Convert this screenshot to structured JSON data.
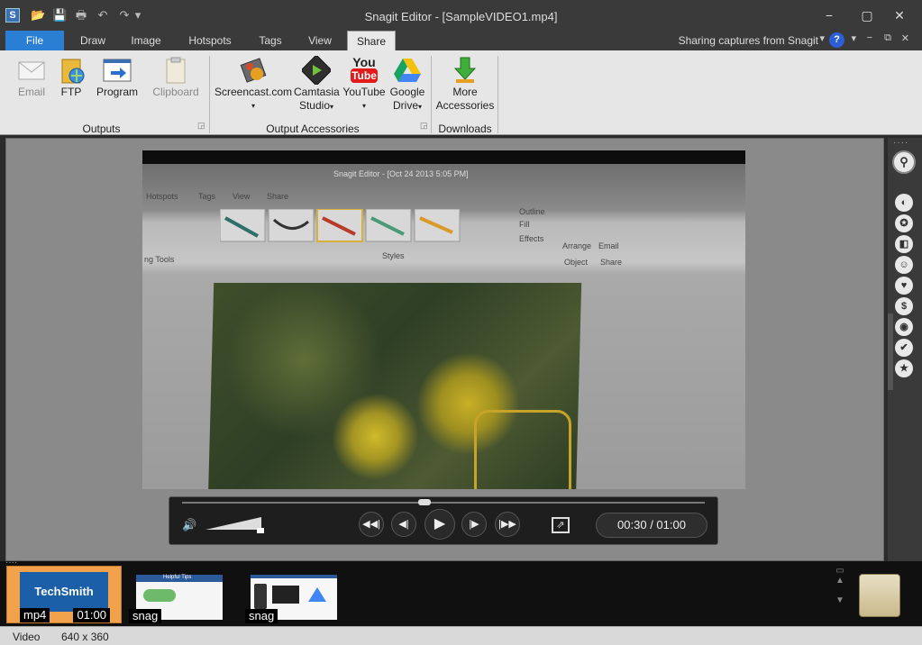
{
  "window": {
    "title": "Snagit Editor - [SampleVIDEO1.mp4]",
    "minimize": "−",
    "maximize": "▢",
    "close": "✕"
  },
  "qat": {
    "open": "📂",
    "save": "💾",
    "print": "🖶",
    "undo": "↶",
    "redo": "↷",
    "customize": "▾"
  },
  "tabs": [
    {
      "label": "File"
    },
    {
      "label": "Draw"
    },
    {
      "label": "Image"
    },
    {
      "label": "Hotspots"
    },
    {
      "label": "Tags"
    },
    {
      "label": "View"
    },
    {
      "label": "Share"
    }
  ],
  "sharing_text": "Sharing captures from Snagit",
  "help": "?",
  "ribbon_ctl": {
    "collapse": "▾",
    "minimize": "−",
    "restore": "⧉",
    "close": "✕"
  },
  "ribbon": {
    "outputs": {
      "label": "Outputs",
      "items": [
        {
          "label": "Email"
        },
        {
          "label": "FTP"
        },
        {
          "label": "Program"
        },
        {
          "label": "Clipboard"
        }
      ]
    },
    "accessories": {
      "label": "Output Accessories",
      "items": [
        {
          "label": "Screencast.com",
          "label2": ""
        },
        {
          "label": "Camtasia",
          "label2": "Studio"
        },
        {
          "label": "YouTube",
          "label2": ""
        },
        {
          "label": "Google",
          "label2": "Drive"
        }
      ]
    },
    "downloads": {
      "label": "Downloads",
      "items": [
        {
          "label": "More",
          "label2": "Accessories"
        }
      ]
    },
    "youtube_logo": {
      "you": "You",
      "tube": "Tube"
    }
  },
  "video_ghost": {
    "title": "Snagit Editor - [Oct 24 2013 5:05 PM]",
    "menu": [
      "Hotspots",
      "Tags",
      "View",
      "Share"
    ],
    "styles": "Styles",
    "tools": "ng Tools",
    "outline": "Outline",
    "fill": "Fill",
    "effects": "Effects",
    "arrange": "Arrange",
    "email": "Email",
    "object": "Object",
    "share": "Share"
  },
  "player": {
    "time": "00:30 / 01:00",
    "volume": "🔊",
    "rewind": "◀◀|",
    "step_back": "◀|",
    "play": "▶",
    "step_forward": "|▶",
    "forward": "|▶▶",
    "export": "⇗"
  },
  "right_panel": {
    "dots": "····",
    "search": "⚲",
    "icons": [
      "◐",
      "✪",
      "◧",
      "☺",
      "♥",
      "$",
      "◉",
      "✔",
      "★"
    ]
  },
  "tray": {
    "items": [
      {
        "type": "mp4",
        "duration": "01:00",
        "brand": "TechSmith"
      },
      {
        "type": "snag",
        "title": "Helpful Tips"
      },
      {
        "type": "snag",
        "title": ""
      }
    ],
    "dots": "····"
  },
  "status": {
    "type": "Video",
    "size": "640 x 360"
  }
}
